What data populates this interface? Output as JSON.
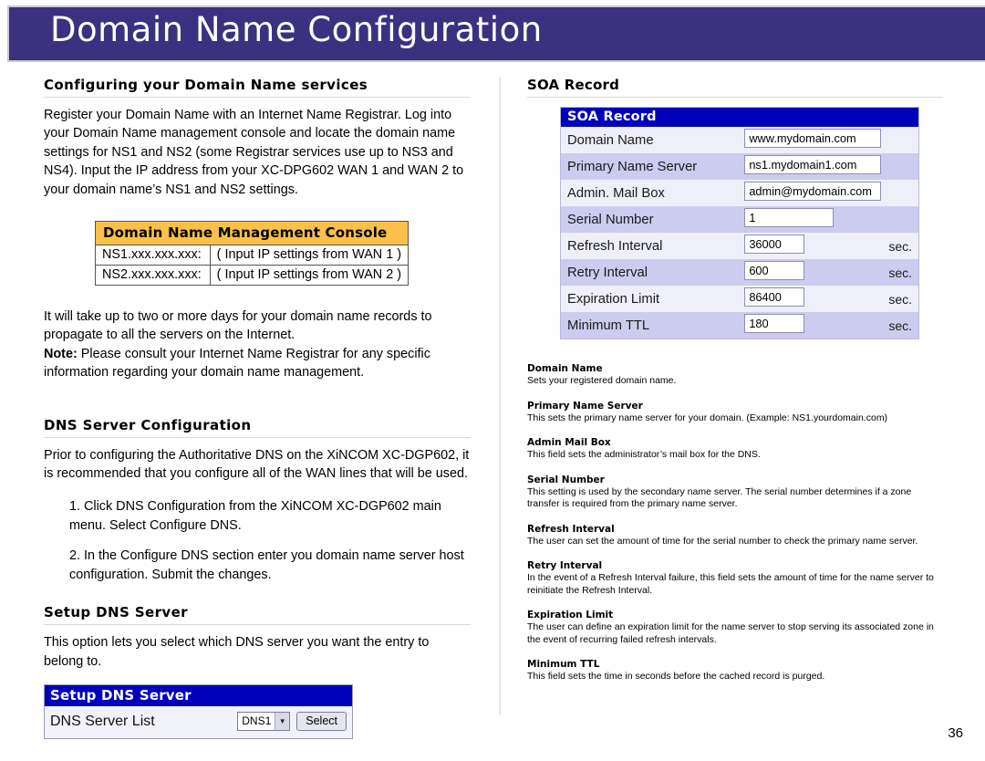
{
  "header": {
    "title": "Domain Name Configuration",
    "bar_color": "#3b3180"
  },
  "page_number": "36",
  "left_column": {
    "section1": {
      "heading": "Configuring your Domain Name services",
      "paragraph": "Register your Domain Name with an Internet Name Registrar. Log into your Domain Name management console and locate the domain name settings for NS1 and NS2 (some Registrar services use up to NS3 and NS4).  Input the IP address from your XC-DPG602 WAN 1 and WAN 2 to your domain name’s NS1 and NS2 settings."
    },
    "console_table": {
      "title": "Domain Name Management Console",
      "title_bg": "#fac049",
      "rows": [
        {
          "key": "NS1.xxx.xxx.xxx:",
          "value": "( Input IP settings from WAN 1 )"
        },
        {
          "key": "NS2.xxx.xxx.xxx:",
          "value": "( Input IP settings from WAN 2 )"
        }
      ]
    },
    "propagate_note": {
      "line1": "It will take up to two or more days for your domain name records to propagate to all the servers on the Internet.",
      "note_label": "Note:",
      "note_text": " Please consult your Internet Name Registrar for any specific information regarding your domain name management."
    },
    "section2": {
      "heading": "DNS Server Configuration",
      "paragraph": "Prior to configuring the Authoritative DNS on the XiNCOM XC-DGP602, it is recommended that you configure all of the WAN lines that will be used.",
      "steps": [
        "1. Click DNS Configuration from the XiNCOM XC-DGP602 main menu. Select Configure DNS.",
        "2. In the Configure DNS section enter you domain name server host configuration. Submit the changes."
      ]
    },
    "section3": {
      "heading": "Setup DNS Server",
      "paragraph": "This option lets you select which DNS server you want the entry to belong to.",
      "widget": {
        "title": "Setup DNS Server",
        "title_bg": "#0000bb",
        "row_label": "DNS Server List",
        "select_value": "DNS1",
        "select_arrow": "▼",
        "button_label": "Select"
      }
    }
  },
  "right_column": {
    "heading": "SOA Record",
    "soa_table": {
      "title": "SOA Record",
      "title_bg": "#0000bb",
      "rows": [
        {
          "label": "Domain Name",
          "value": "www.mydomain.com",
          "unit": "",
          "field": "wide"
        },
        {
          "label": "Primary Name Server",
          "value": "ns1.mydomain1.com",
          "unit": "",
          "field": "wide"
        },
        {
          "label": "Admin. Mail Box",
          "value": "admin@mydomain.com",
          "unit": "",
          "field": "wide"
        },
        {
          "label": "Serial Number",
          "value": "1",
          "unit": "",
          "field": "ser"
        },
        {
          "label": "Refresh Interval",
          "value": "36000",
          "unit": "sec.",
          "field": "num"
        },
        {
          "label": "Retry Interval",
          "value": "600",
          "unit": "sec.",
          "field": "num"
        },
        {
          "label": "Expiration Limit",
          "value": "86400",
          "unit": "sec.",
          "field": "num"
        },
        {
          "label": "Minimum TTL",
          "value": "180",
          "unit": "sec.",
          "field": "num"
        }
      ]
    },
    "descriptions": [
      {
        "term": "Domain Name",
        "definition": "Sets your registered domain name."
      },
      {
        "term": "Primary Name Server",
        "definition": "This sets the primary name server for your domain.  (Example: NS1.yourdomain.com)"
      },
      {
        "term": "Admin Mail Box",
        "definition": "This field sets the administrator’s mail box for the DNS."
      },
      {
        "term": "Serial Number",
        "definition": "This setting is used by the secondary name server.  The serial number determines if a zone transfer is required from the primary name server."
      },
      {
        "term": "Refresh Interval",
        "definition": "The user can set the amount of time for the serial number to check the primary name server."
      },
      {
        "term": "Retry Interval",
        "definition": "In the event of a Refresh Interval failure, this field sets the amount of time for the name server to reinitiate the Refresh Interval."
      },
      {
        "term": "Expiration Limit",
        "definition": "The user can define an expiration limit for the name server to stop serving its associated zone in the event of recurring failed refresh intervals."
      },
      {
        "term": "Minimum TTL",
        "definition": "This field sets the time in seconds before the cached record is purged."
      }
    ]
  }
}
